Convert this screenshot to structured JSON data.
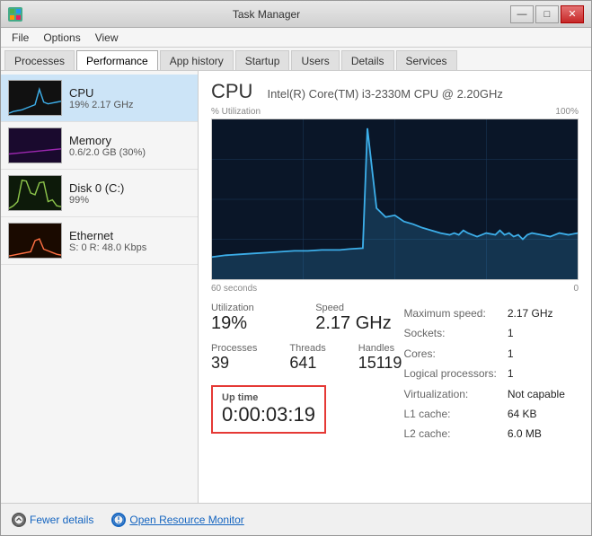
{
  "window": {
    "title": "Task Manager",
    "icon": "TM"
  },
  "title_buttons": {
    "minimize": "—",
    "maximize": "□",
    "close": "✕"
  },
  "menu": {
    "items": [
      "File",
      "Options",
      "View"
    ]
  },
  "tabs": [
    {
      "label": "Processes",
      "active": false
    },
    {
      "label": "Performance",
      "active": true
    },
    {
      "label": "App history",
      "active": false
    },
    {
      "label": "Startup",
      "active": false
    },
    {
      "label": "Users",
      "active": false
    },
    {
      "label": "Details",
      "active": false
    },
    {
      "label": "Services",
      "active": false
    }
  ],
  "left_panel": {
    "items": [
      {
        "name": "CPU",
        "value": "19% 2.17 GHz",
        "active": true,
        "color": "#3daee9"
      },
      {
        "name": "Memory",
        "value": "0.6/2.0 GB (30%)",
        "active": false,
        "color": "#9c27b0"
      },
      {
        "name": "Disk 0 (C:)",
        "value": "99%",
        "active": false,
        "color": "#8bc34a"
      },
      {
        "name": "Ethernet",
        "value": "S: 0  R: 48.0 Kbps",
        "active": false,
        "color": "#ff7043"
      }
    ]
  },
  "cpu": {
    "title": "CPU",
    "subtitle": "Intel(R) Core(TM) i3-2330M CPU @ 2.20GHz",
    "chart_label_top": "% Utilization",
    "chart_label_top_right": "100%",
    "chart_label_bottom_left": "60 seconds",
    "chart_label_bottom_right": "0",
    "utilization_label": "Utilization",
    "utilization_value": "19%",
    "speed_label": "Speed",
    "speed_value": "2.17 GHz",
    "processes_label": "Processes",
    "processes_value": "39",
    "threads_label": "Threads",
    "threads_value": "641",
    "handles_label": "Handles",
    "handles_value": "15119",
    "uptime_label": "Up time",
    "uptime_value": "0:00:03:19",
    "details": {
      "maximum_speed_label": "Maximum speed:",
      "maximum_speed_value": "2.17 GHz",
      "sockets_label": "Sockets:",
      "sockets_value": "1",
      "cores_label": "Cores:",
      "cores_value": "1",
      "logical_processors_label": "Logical processors:",
      "logical_processors_value": "1",
      "virtualization_label": "Virtualization:",
      "virtualization_value": "Not capable",
      "l1_cache_label": "L1 cache:",
      "l1_cache_value": "64 KB",
      "l2_cache_label": "L2 cache:",
      "l2_cache_value": "6.0 MB"
    }
  },
  "footer": {
    "fewer_details_label": "Fewer details",
    "open_resource_monitor_label": "Open Resource Monitor"
  }
}
